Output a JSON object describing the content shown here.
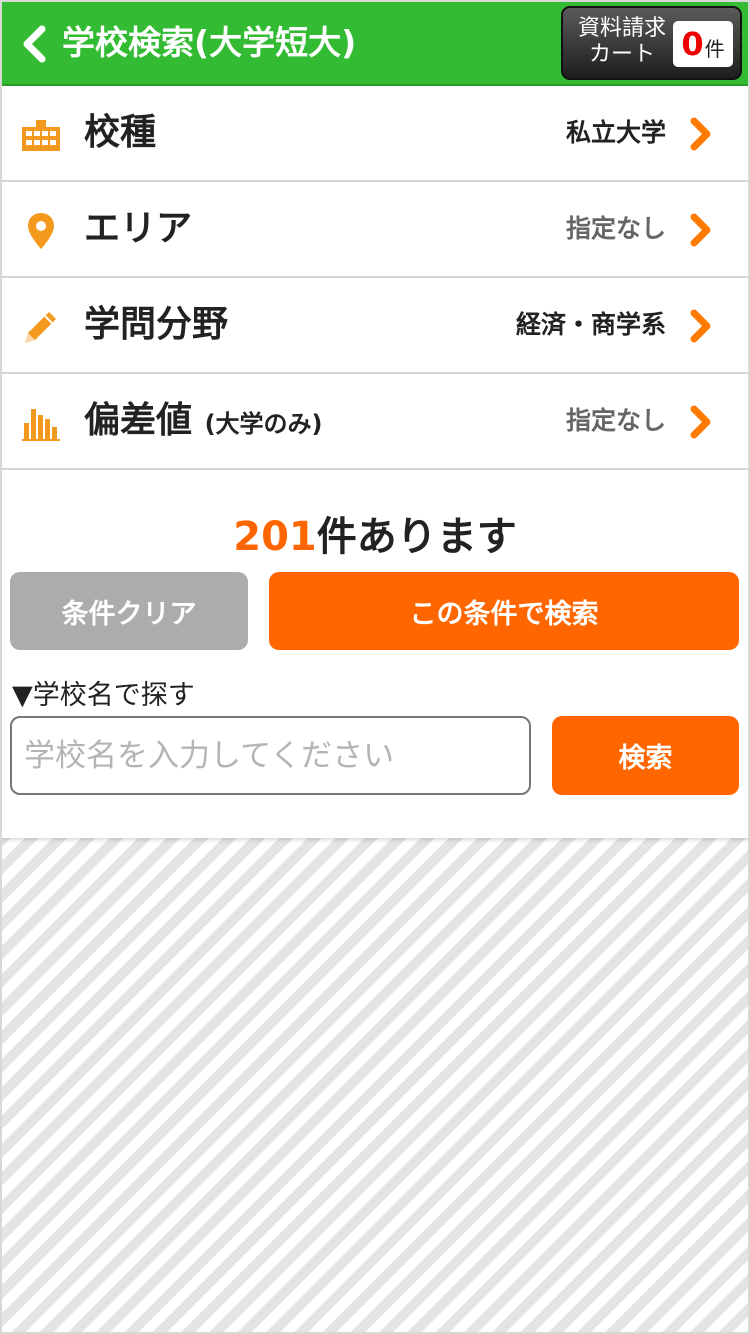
{
  "header": {
    "title": "学校検索(大学短大)",
    "cart_label": "資料請求\nカート",
    "cart_count": "0",
    "cart_unit": "件"
  },
  "filters": [
    {
      "icon": "school-building-icon",
      "label": "校種",
      "sub": "",
      "value": "私立大学"
    },
    {
      "icon": "location-pin-icon",
      "label": "エリア",
      "sub": "",
      "value": "指定なし"
    },
    {
      "icon": "pencil-icon",
      "label": "学問分野",
      "sub": "",
      "value": "経済・商学系"
    },
    {
      "icon": "bar-chart-icon",
      "label": "偏差値",
      "sub": "(大学のみ)",
      "value": "指定なし"
    }
  ],
  "results": {
    "count": "201",
    "suffix": "件あります"
  },
  "buttons": {
    "clear": "条件クリア",
    "search_conditions": "この条件で検索"
  },
  "name_search": {
    "heading": "▼学校名で探す",
    "placeholder": "学校名を入力してください",
    "button": "検索"
  },
  "colors": {
    "header_green": "#33bb33",
    "accent_orange": "#ff6600",
    "clear_gray": "#acacac"
  }
}
